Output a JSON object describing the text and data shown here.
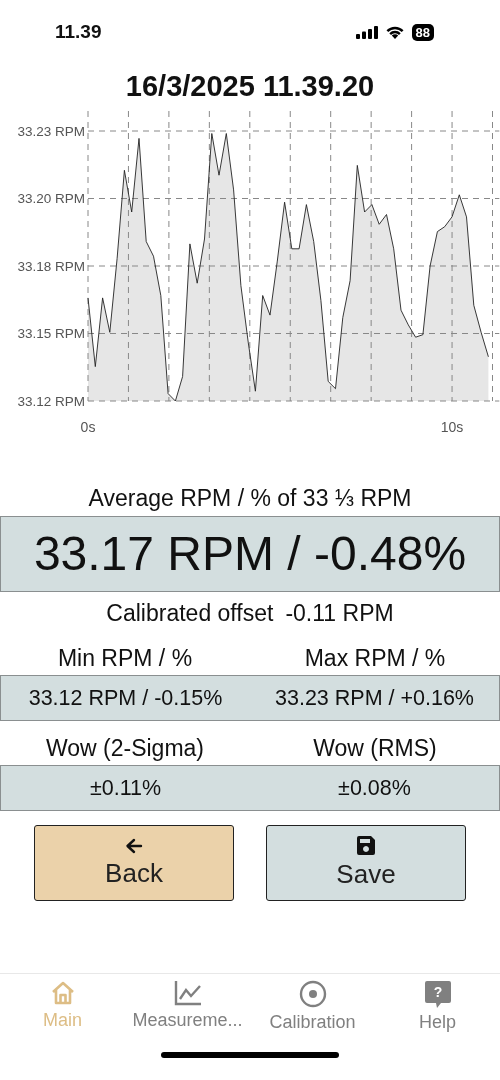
{
  "status_bar": {
    "time": "11.39",
    "battery": "88"
  },
  "title": "16/3/2025 11.39.20",
  "chart": {
    "chart_data": {
      "type": "area",
      "xlim": [
        0,
        11.3
      ],
      "ylim": [
        33.12,
        33.23
      ],
      "yticks": [
        {
          "value": 33.12,
          "label": "33.12 RPM"
        },
        {
          "value": 33.1475,
          "label": "33.15 RPM"
        },
        {
          "value": 33.175,
          "label": "33.18 RPM"
        },
        {
          "value": 33.2025,
          "label": "33.20 RPM"
        },
        {
          "value": 33.23,
          "label": "33.23 RPM"
        }
      ],
      "xticks": [
        {
          "value": 0,
          "label": "0s"
        },
        {
          "value": 10,
          "label": "10s"
        }
      ],
      "grid": true,
      "x": [
        0,
        0.2,
        0.4,
        0.6,
        0.8,
        1,
        1.2,
        1.4,
        1.6,
        1.8,
        2,
        2.2,
        2.4,
        2.6,
        2.8,
        3,
        3.2,
        3.4,
        3.6,
        3.8,
        4,
        4.2,
        4.4,
        4.6,
        4.8,
        5,
        5.2,
        5.4,
        5.6,
        5.8,
        6,
        6.2,
        6.4,
        6.6,
        6.8,
        7,
        7.2,
        7.4,
        7.6,
        7.8,
        8,
        8.2,
        8.4,
        8.6,
        8.8,
        9,
        9.2,
        9.4,
        9.6,
        9.8,
        10,
        10.2,
        10.4,
        10.6,
        10.8,
        11
      ],
      "series": [
        {
          "color": "#e6e6e6",
          "values": [
            33.162,
            33.134,
            33.162,
            33.148,
            33.178,
            33.214,
            33.197,
            33.227,
            33.185,
            33.179,
            33.163,
            33.123,
            33.12,
            33.13,
            33.184,
            33.168,
            33.186,
            33.229,
            33.212,
            33.229,
            33.206,
            33.167,
            33.144,
            33.124,
            33.163,
            33.155,
            33.177,
            33.201,
            33.182,
            33.182,
            33.2,
            33.185,
            33.161,
            33.128,
            33.125,
            33.154,
            33.169,
            33.216,
            33.197,
            33.2,
            33.192,
            33.196,
            33.182,
            33.157,
            33.151,
            33.146,
            33.147,
            33.175,
            33.189,
            33.191,
            33.195,
            33.204,
            33.195,
            33.159,
            33.148,
            33.138
          ]
        }
      ]
    }
  },
  "average": {
    "label": "Average RPM / % of 33 ⅓ RPM",
    "value": "33.17 RPM / -0.48%"
  },
  "calibrated_offset": {
    "label": "Calibrated offset",
    "value": "-0.11 RPM"
  },
  "stat_pairs": [
    {
      "items": [
        {
          "label": "Min RPM / %",
          "value": "33.12 RPM / -0.15%"
        },
        {
          "label": "Max RPM / %",
          "value": "33.23 RPM / +0.16%"
        }
      ]
    },
    {
      "items": [
        {
          "label": "Wow (2-Sigma)",
          "value": "±0.11%"
        },
        {
          "label": "Wow (RMS)",
          "value": "±0.08%"
        }
      ]
    }
  ],
  "buttons": [
    {
      "kind": "back",
      "label": "Back"
    },
    {
      "kind": "save",
      "label": "Save"
    }
  ],
  "tabs": [
    {
      "kind": "home",
      "label": "Main",
      "selected": true
    },
    {
      "kind": "chart",
      "label": "Measureme...",
      "selected": false
    },
    {
      "kind": "target",
      "label": "Calibration",
      "selected": false
    },
    {
      "kind": "help",
      "label": "Help",
      "selected": false,
      "icon_glyph": "?"
    }
  ]
}
